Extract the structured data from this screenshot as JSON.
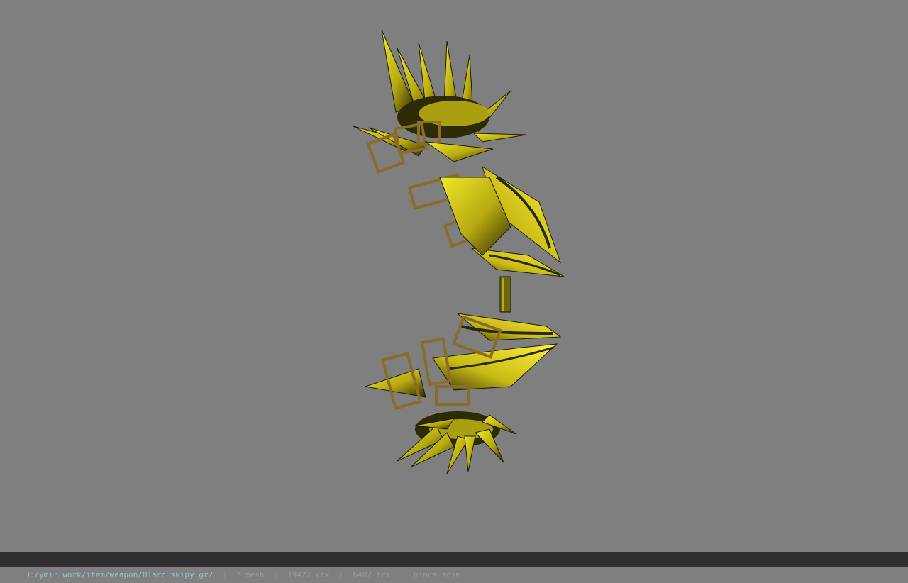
{
  "viewer": {
    "background_color": "#7f7f7f",
    "model_primary_color": "#e2d81a",
    "model_dark_color": "#2d2a04"
  },
  "status": {
    "path": "D:/ymir work/item/weapon/01arc_skipy.gr2",
    "separator": "|",
    "mesh": "2 mesh",
    "vtx": "19422 vtx",
    "tri": "6482 tri",
    "anim": "nincs anim"
  }
}
